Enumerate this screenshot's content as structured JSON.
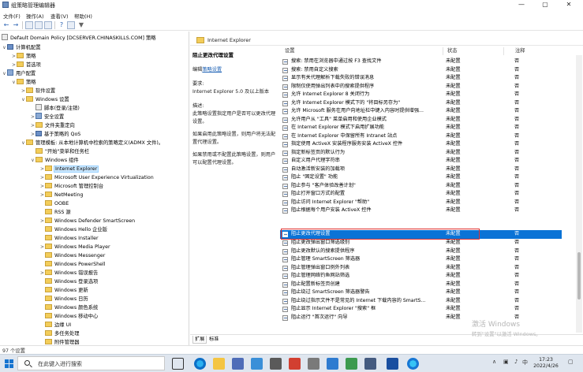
{
  "window": {
    "title": "组策略管理编辑器",
    "buttons": {
      "minimize": "—",
      "maximize": "▢",
      "close": "✕"
    }
  },
  "menu": [
    "文件(F)",
    "操作(A)",
    "查看(V)",
    "帮助(H)"
  ],
  "tree": {
    "items": [
      "Default Domain Policy [DCSERVER.CHINASKILLS.COM] 策略",
      "计算机配置",
      "策略",
      "首选项",
      "用户配置",
      "策略",
      "软件设置",
      "Windows 设置",
      "脚本(登录/注销)",
      "安全设置",
      "文件夹重定向",
      "基于策略的 QoS",
      "管理模板: 从本地计算机中检索的策略定义(ADMX 文件)。",
      "\"开始\"菜单和任务栏",
      "Windows 组件",
      "Internet Explorer",
      "Microsoft User Experience Virtualization",
      "Microsoft 管理控制台",
      "NetMeeting",
      "OOBE",
      "RSS 源",
      "Windows Defender SmartScreen",
      "Windows Hello 企业版",
      "Windows Installer",
      "Windows Media Player",
      "Windows Messenger",
      "Windows PowerShell",
      "Windows 错误报告",
      "Windows 登录选项",
      "Windows 更新",
      "Windows 日历",
      "Windows 颜色系统",
      "Windows 移动中心",
      "边缘 UI",
      "多任务处理",
      "附件管理器"
    ]
  },
  "header": {
    "title": "Internet Explorer"
  },
  "description": {
    "title": "阻止更改代理设置",
    "edit_prefix": "编辑",
    "edit_link": "策略设置",
    "req_label": "要求:",
    "req_value": "Internet Explorer 5.0 及以上版本",
    "desc_label": "描述:",
    "desc_value": "此策略设置指定用户是否可以更改代理设置。",
    "enabled_text": "如果启用此策略设置，则用户将无法配置代理设置。",
    "disabled_text": "如果禁用或不配置此策略设置，则用户可以配置代理设置。"
  },
  "list": {
    "columns": {
      "setting": "设置",
      "state": "状态",
      "comment": "注释"
    },
    "rows": [
      {
        "setting": "搜索: 禁用在浏览器中通过按 F3 查找文件",
        "state": "未配置",
        "comment": "否"
      },
      {
        "setting": "搜索: 禁用自定义搜索",
        "state": "未配置",
        "comment": "否"
      },
      {
        "setting": "显示有关代理解析下载失败的错误消息",
        "state": "未配置",
        "comment": "否"
      },
      {
        "setting": "限制仅使用弹出列表中的搜索提供程序",
        "state": "未配置",
        "comment": "否"
      },
      {
        "setting": "允许 Internet Explorer 8 关闭行为",
        "state": "未配置",
        "comment": "否"
      },
      {
        "setting": "允许 Internet Explorer 模式下的 \"将目标另存为\"",
        "state": "未配置",
        "comment": "否"
      },
      {
        "setting": "允许 Microsoft 服务在用户向地址栏中键入内容时提供增强...",
        "state": "未配置",
        "comment": "否"
      },
      {
        "setting": "允许用户从 \"工具\" 菜单启用和使用企业模式",
        "state": "未配置",
        "comment": "否"
      },
      {
        "setting": "在 Internet Explorer 模式下启用扩展功能",
        "state": "未配置",
        "comment": "否"
      },
      {
        "setting": "在 Internet Explorer 中保留所有 Intranet 站点",
        "state": "未配置",
        "comment": "否"
      },
      {
        "setting": "指定使用 ActiveX 安装程序服务安装 ActiveX 控件",
        "state": "未配置",
        "comment": "否"
      },
      {
        "setting": "指定新标签页的默认行为",
        "state": "未配置",
        "comment": "否"
      },
      {
        "setting": "自定义用户代理字符串",
        "state": "未配置",
        "comment": "否"
      },
      {
        "setting": "自动激活新安装的加载项",
        "state": "未配置",
        "comment": "否"
      },
      {
        "setting": "阻止 \"固定设置\" 功能",
        "state": "未配置",
        "comment": "否"
      },
      {
        "setting": "阻止参与 \"客户体验改善计划\"",
        "state": "未配置",
        "comment": "否"
      },
      {
        "setting": "阻止打开窗口方式的配置",
        "state": "未配置",
        "comment": "否"
      },
      {
        "setting": "阻止访问 Internet Explorer \"帮助\"",
        "state": "未配置",
        "comment": "否"
      },
      {
        "setting": "阻止根据每个用户安装 ActiveX 控件",
        "state": "未配置",
        "comment": "否"
      },
      {
        "setting": "阻止更改代理设置",
        "state": "未配置",
        "comment": "否"
      },
      {
        "setting": "阻止更改弹出窗口筛选级别",
        "state": "未配置",
        "comment": "否"
      },
      {
        "setting": "阻止更改默认的搜索提供程序",
        "state": "未配置",
        "comment": "否"
      },
      {
        "setting": "阻止管理 SmartScreen 筛选器",
        "state": "未配置",
        "comment": "否"
      },
      {
        "setting": "阻止管理弹出窗口例外列表",
        "state": "未配置",
        "comment": "否"
      },
      {
        "setting": "阻止管理网络钓鱼网站筛选",
        "state": "未配置",
        "comment": "否"
      },
      {
        "setting": "阻止配置新标签页创建",
        "state": "未配置",
        "comment": "否"
      },
      {
        "setting": "阻止绕过 SmartScreen 筛选器警告",
        "state": "未配置",
        "comment": "否"
      },
      {
        "setting": "阻止绕过指示文件不是常见的 Internet 下载内容的 SmartS...",
        "state": "未配置",
        "comment": "否"
      },
      {
        "setting": "阻止显示 Internet Explorer \"搜索\" 框",
        "state": "未配置",
        "comment": "否"
      },
      {
        "setting": "阻止运行 \"首次运行\" 向导",
        "state": "未配置",
        "comment": "否"
      }
    ]
  },
  "tabs": [
    "扩展",
    "标准"
  ],
  "status": {
    "text": "97 个设置"
  },
  "watermark": {
    "line1": "激活 Windows",
    "line2": "转到\"设置\"以激活 Windows。"
  },
  "taskbar": {
    "search_placeholder": "在此键入进行搜索",
    "clock_time": "17:23",
    "clock_date": "2022/4/26",
    "tray_lang": "中"
  },
  "colors": {
    "selection": "#0a73d6",
    "highlight_box": "#e0312f",
    "folder": "#f3cd5a",
    "link": "#1a5fb4"
  }
}
